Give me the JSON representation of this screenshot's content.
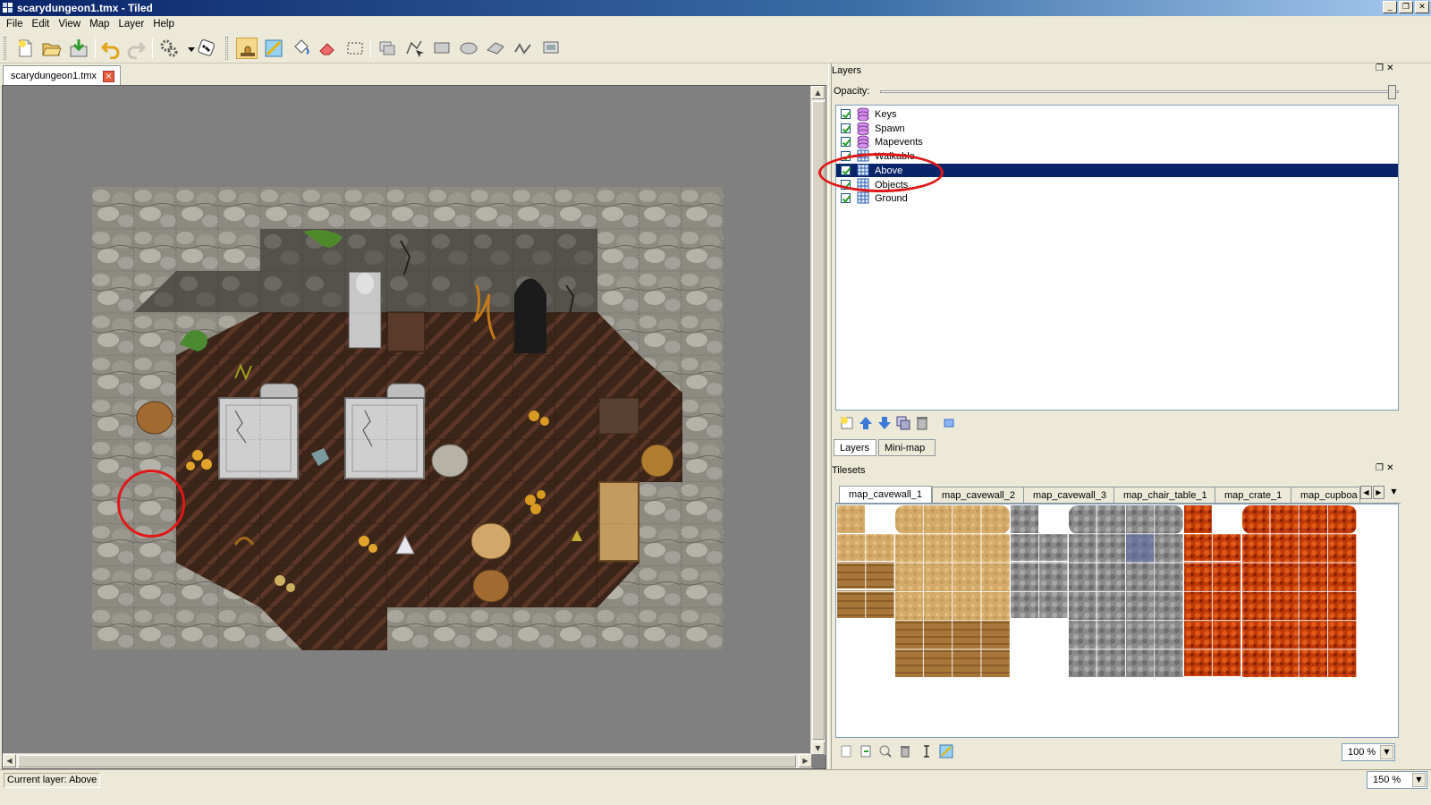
{
  "window": {
    "title": "scarydungeon1.tmx - Tiled",
    "controls": [
      "_",
      "❐",
      "✕"
    ]
  },
  "menu": [
    "File",
    "Edit",
    "View",
    "Map",
    "Layer",
    "Help"
  ],
  "toolbar": {
    "tools": [
      "new-file",
      "open-file",
      "save-file",
      "undo",
      "redo",
      "command-button",
      "command-dropdown",
      "random-mode",
      "stamp-brush",
      "terrain-brush",
      "bucket-fill",
      "eraser",
      "rectangular-select",
      "select-objects",
      "edit-polygons",
      "insert-rectangle",
      "insert-ellipse",
      "insert-polygon",
      "insert-polyline",
      "insert-tile"
    ]
  },
  "document": {
    "tab_label": "scarydungeon1.tmx",
    "close_glyph": "×"
  },
  "layers_panel": {
    "title": "Layers",
    "opacity_label": "Opacity:",
    "opacity_value": 1.0,
    "layers": [
      {
        "name": "Keys",
        "type": "object",
        "visible": true
      },
      {
        "name": "Spawn",
        "type": "object",
        "visible": true
      },
      {
        "name": "Mapevents",
        "type": "object",
        "visible": true
      },
      {
        "name": "Walkable",
        "type": "tile",
        "visible": true
      },
      {
        "name": "Above",
        "type": "tile",
        "visible": true,
        "selected": true
      },
      {
        "name": "Objects",
        "type": "tile",
        "visible": true
      },
      {
        "name": "Ground",
        "type": "tile",
        "visible": true
      }
    ],
    "tabs": [
      "Layers",
      "Mini-map"
    ]
  },
  "tilesets_panel": {
    "title": "Tilesets",
    "tabs": [
      "map_cavewall_1",
      "map_cavewall_2",
      "map_cavewall_3",
      "map_chair_table_1",
      "map_crate_1",
      "map_cupboa"
    ],
    "active_tab": "map_cavewall_1",
    "zoom": "100 %",
    "zoom_dropdown": "▼",
    "scroll_left": "◀",
    "scroll_right": "▶",
    "menu_arrow": "▼"
  },
  "status": {
    "current_layer": "Current layer: Above",
    "map_zoom": "150 %"
  },
  "colors": {
    "selection": "#0a246a",
    "annotation": "#e01818",
    "title_gradient_start": "#0a246a",
    "cave_floor": "#3b2418",
    "cave_wall": "#8d8a82"
  }
}
